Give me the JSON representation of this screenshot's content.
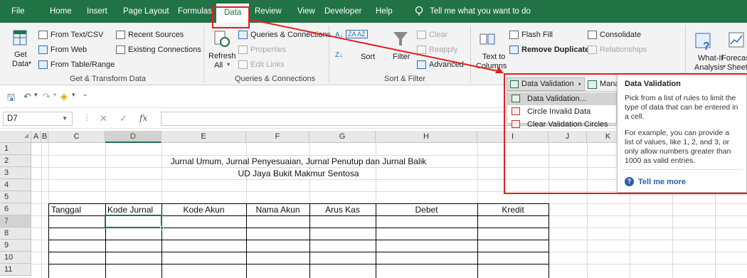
{
  "tabs": [
    "File",
    "Home",
    "Insert",
    "Page Layout",
    "Formulas",
    "Data",
    "Review",
    "View",
    "Developer",
    "Help"
  ],
  "active_tab": "Data",
  "tell_me": "Tell me what you want to do",
  "ribbon": {
    "get_data": "Get",
    "get_data2": "Data",
    "from_text_csv": "From Text/CSV",
    "from_web": "From Web",
    "from_table_range": "From Table/Range",
    "recent_sources": "Recent Sources",
    "existing_connections": "Existing Connections",
    "group_get_transform": "Get & Transform Data",
    "refresh": "Refresh",
    "refresh_all": "All",
    "queries_connections": "Queries & Connections",
    "properties": "Properties",
    "edit_links": "Edit Links",
    "group_queries": "Queries & Connections",
    "sort": "Sort",
    "filter": "Filter",
    "clear": "Clear",
    "reapply": "Reapply",
    "advanced": "Advanced",
    "group_sort_filter": "Sort & Filter",
    "text_to": "Text to",
    "columns": "Columns",
    "flash_fill": "Flash Fill",
    "remove_duplicates": "Remove Duplicates",
    "consolidate": "Consolidate",
    "relationships": "Relationships",
    "data_validation": "Data Validation",
    "manage_data_model": "Manage Data Model",
    "what_if": "What-If",
    "analysis": "Analysis",
    "forecast": "Forecast",
    "sheet": "Sheet"
  },
  "dropdown": {
    "items": [
      "Data Validation...",
      "Circle Invalid Data",
      "Clear Validation Circles"
    ]
  },
  "tooltip": {
    "title": "Data Validation",
    "p1": "Pick from a list of rules to limit the type of data that can be entered in a cell.",
    "p2": "For example, you can provide a list of values, like 1, 2, and 3, or only allow numbers greater than 1000 as valid entries.",
    "more": "Tell me more"
  },
  "formula_bar": {
    "name_box": "D7",
    "fx": "fx",
    "value": ""
  },
  "columns": [
    "A",
    "B",
    "C",
    "D",
    "E",
    "F",
    "G",
    "H",
    "I",
    "J",
    "K"
  ],
  "rows": [
    "1",
    "2",
    "3",
    "4",
    "5",
    "6",
    "7",
    "8",
    "9",
    "10",
    "11"
  ],
  "sheet": {
    "title": "Jurnal Umum, Jurnal Penyesuaian, Jurnal Penutup dan Jurnal Balik",
    "subtitle": "UD Jaya Bukit Makmur Sentosa",
    "headers": [
      "Tanggal",
      "Kode Jurnal",
      "Kode Akun",
      "Nama Akun",
      "Arus Kas",
      "Debet",
      "Kredit"
    ]
  },
  "colors": {
    "excel_green": "#217346",
    "annotation_red": "#e02020",
    "link_blue": "#2e5ea8"
  }
}
